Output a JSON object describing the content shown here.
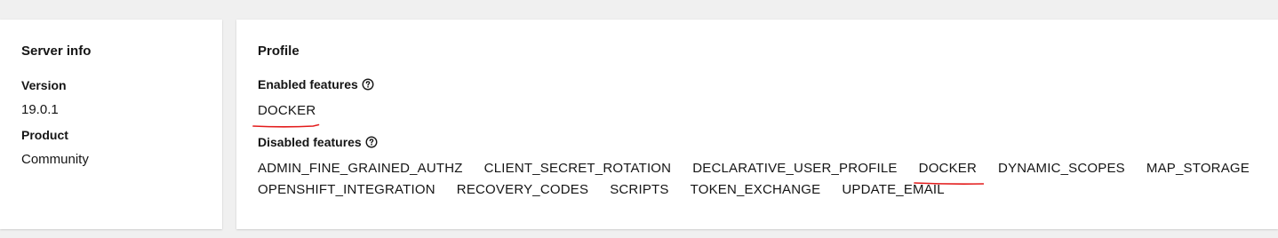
{
  "server_info": {
    "title": "Server info",
    "version_label": "Version",
    "version_value": "19.0.1",
    "product_label": "Product",
    "product_value": "Community"
  },
  "profile": {
    "title": "Profile",
    "enabled_label": "Enabled features",
    "enabled_features": [
      "DOCKER"
    ],
    "disabled_label": "Disabled features",
    "disabled_features": [
      "ADMIN_FINE_GRAINED_AUTHZ",
      "CLIENT_SECRET_ROTATION",
      "DECLARATIVE_USER_PROFILE",
      "DOCKER",
      "DYNAMIC_SCOPES",
      "MAP_STORAGE",
      "OPENSHIFT_INTEGRATION",
      "RECOVERY_CODES",
      "SCRIPTS",
      "TOKEN_EXCHANGE",
      "UPDATE_EMAIL"
    ]
  },
  "annotation_color": "#e31b1b",
  "help_icon": "question-circle-icon"
}
